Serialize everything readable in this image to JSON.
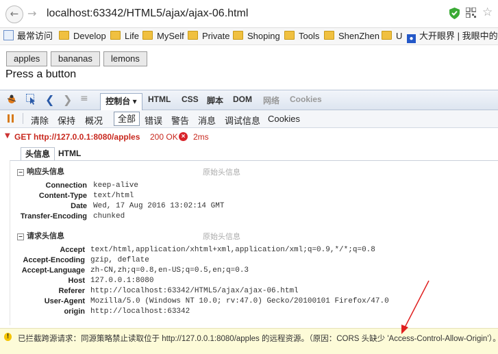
{
  "browser": {
    "url": "localhost:63342/HTML5/ajax/ajax-06.html",
    "back_glyph": "←",
    "forward_glyph": "→",
    "star_glyph": "☆"
  },
  "bookmarks": [
    {
      "label": "最常访问"
    },
    {
      "label": "Develop"
    },
    {
      "label": "Life"
    },
    {
      "label": "MySelf"
    },
    {
      "label": "Private"
    },
    {
      "label": "Shoping"
    },
    {
      "label": "Tools"
    },
    {
      "label": "ShenZhen"
    },
    {
      "label": "U"
    },
    {
      "label": "大开眼界 | 我眼中的"
    }
  ],
  "page": {
    "buttons": [
      "apples",
      "bananas",
      "lemons"
    ],
    "message": "Press a button"
  },
  "devtools": {
    "tabs": [
      "控制台",
      "HTML",
      "CSS",
      "脚本",
      "DOM",
      "网络",
      "Cookies"
    ],
    "console_tab_arrow": "▾",
    "subtoolbar": [
      "清除",
      "保持",
      "概况",
      "全部",
      "错误",
      "警告",
      "消息",
      "调试信息",
      "Cookies"
    ],
    "request": {
      "method_url": "GET http://127.0.0.1:8080/apples",
      "status": "200 OK",
      "error_glyph": "×",
      "time": "2ms"
    },
    "detail_tabs": [
      "头信息",
      "HTML"
    ],
    "response_headers": {
      "title": "响应头信息",
      "raw_link": "原始头信息",
      "rows": [
        {
          "key": "Connection",
          "value": "keep-alive"
        },
        {
          "key": "Content-Type",
          "value": "text/html"
        },
        {
          "key": "Date",
          "value": "Wed, 17 Aug 2016 13:02:14 GMT"
        },
        {
          "key": "Transfer-Encoding",
          "value": "chunked"
        }
      ]
    },
    "request_headers": {
      "title": "请求头信息",
      "raw_link": "原始头信息",
      "rows": [
        {
          "key": "Accept",
          "value": "text/html,application/xhtml+xml,application/xml;q=0.9,*/*;q=0.8"
        },
        {
          "key": "Accept-Encoding",
          "value": "gzip, deflate"
        },
        {
          "key": "Accept-Language",
          "value": "zh-CN,zh;q=0.8,en-US;q=0.5,en;q=0.3"
        },
        {
          "key": "Host",
          "value": "127.0.0.1:8080"
        },
        {
          "key": "Referer",
          "value": "http://localhost:63342/HTML5/ajax/ajax-06.html"
        },
        {
          "key": "User-Agent",
          "value": "Mozilla/5.0 (Windows NT 10.0; rv:47.0) Gecko/20100101 Firefox/47.0"
        },
        {
          "key": "origin",
          "value": "http://localhost:63342"
        }
      ]
    },
    "warning": {
      "icon_glyph": "!",
      "text": "已拦截跨源请求：同源策略禁止读取位于 http://127.0.0.1:8080/apples 的远程资源。（原因：CORS 头缺少 'Access-Control-Allow-Origin'）。"
    }
  }
}
